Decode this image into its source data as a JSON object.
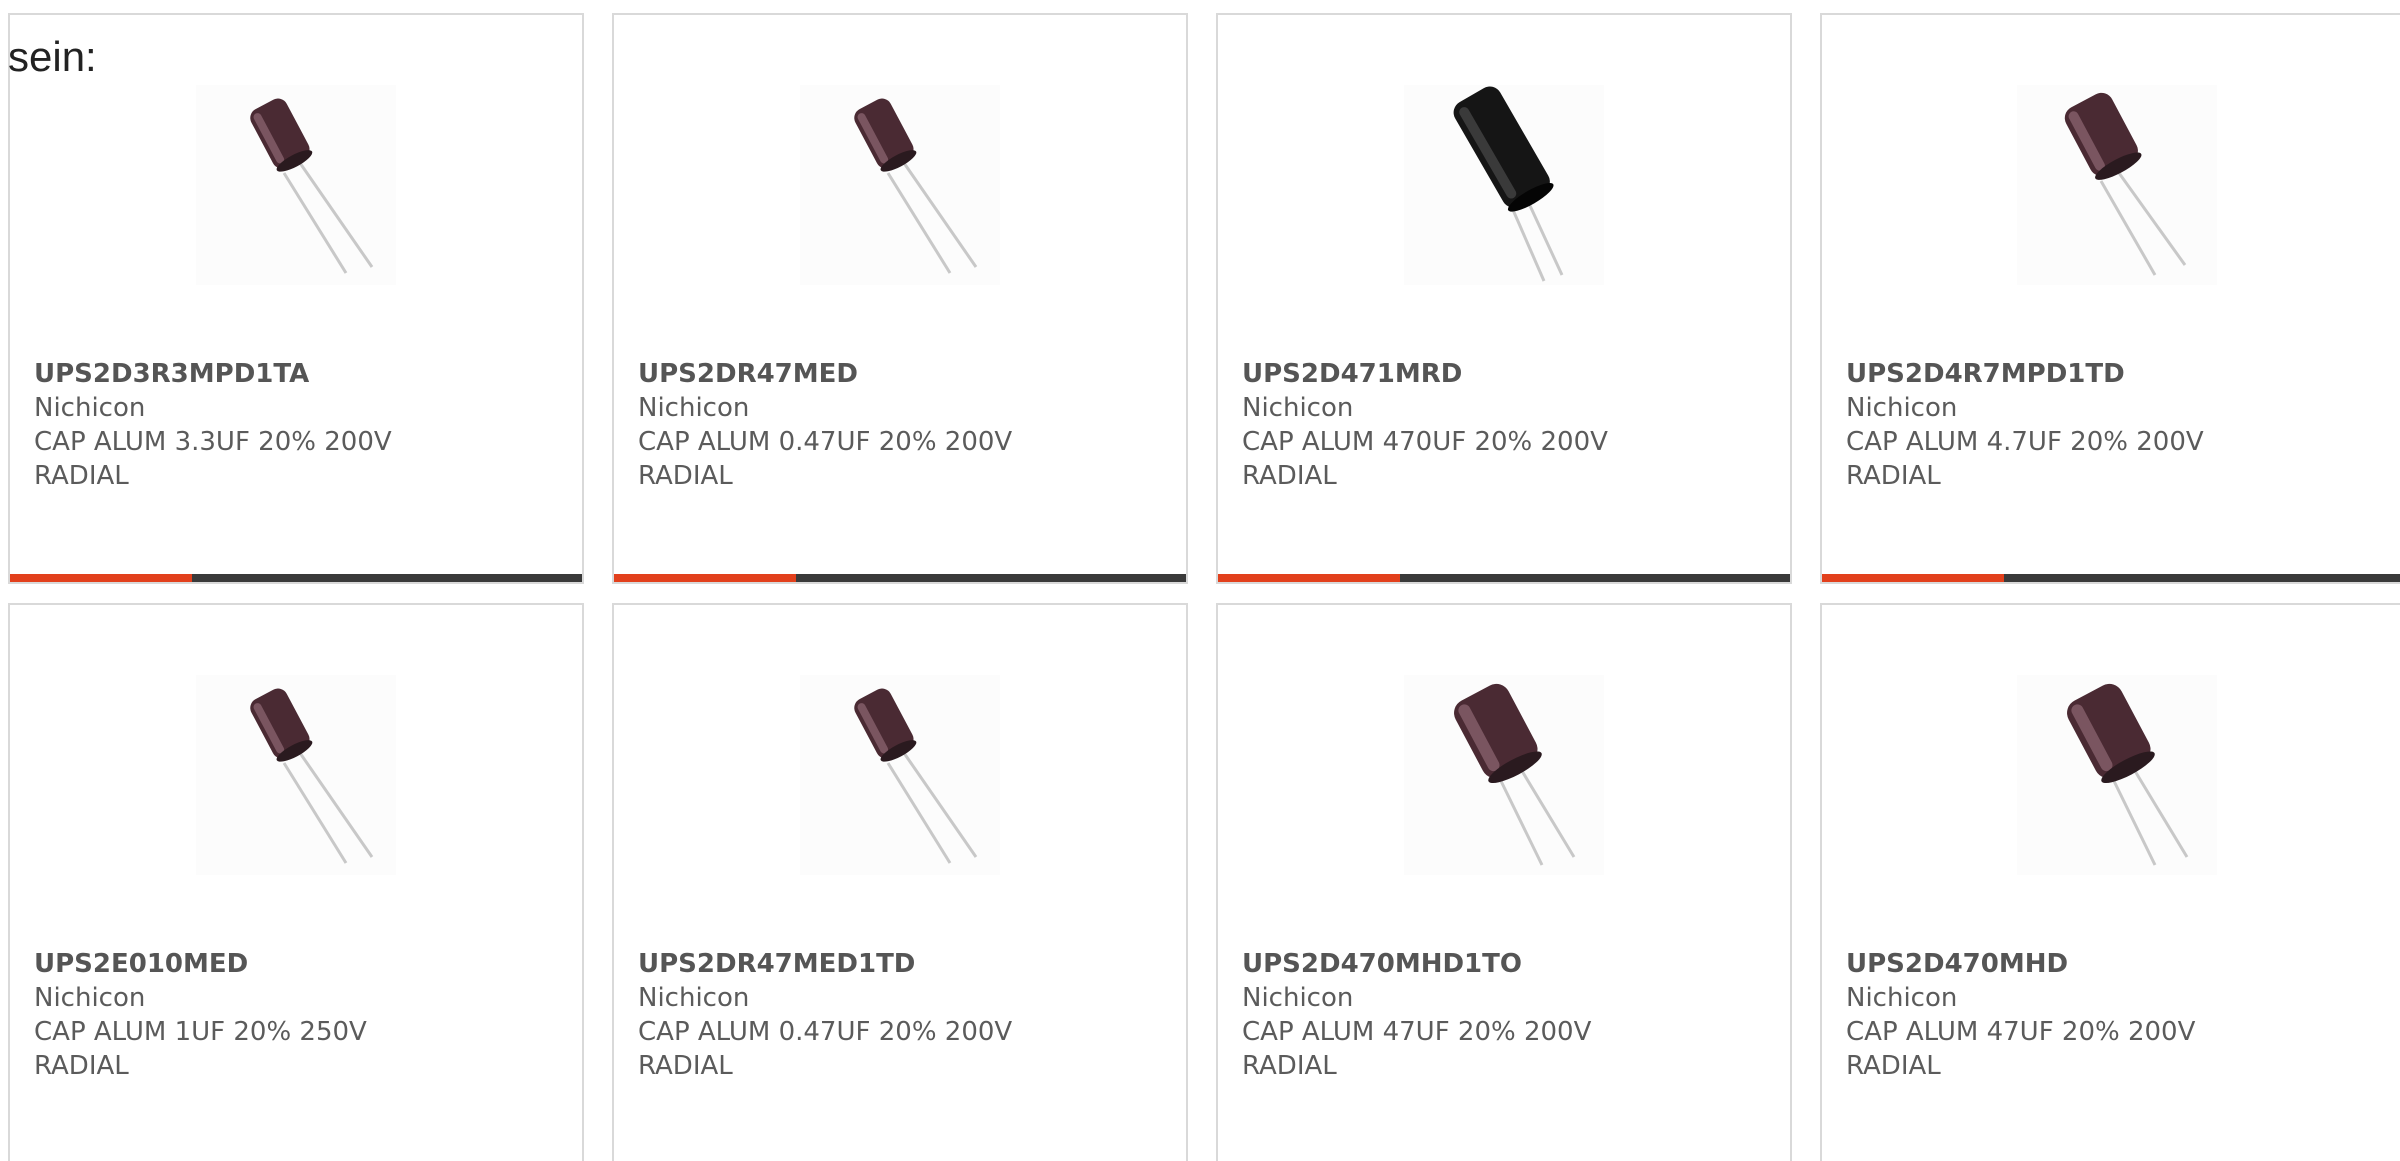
{
  "intro_text": "sein:",
  "colors": {
    "accent_bar": "#e2401c",
    "dark_bar": "#3a3a3a",
    "card_border": "#d9d9d9"
  },
  "products": [
    {
      "part": "UPS2D3R3MPD1TA",
      "manufacturer": "Nichicon",
      "desc_line1": "CAP ALUM 3.3UF 20% 200V",
      "desc_line2": "RADIAL",
      "image": "capacitor-image"
    },
    {
      "part": "UPS2DR47MED",
      "manufacturer": "Nichicon",
      "desc_line1": "CAP ALUM 0.47UF 20% 200V",
      "desc_line2": "RADIAL",
      "image": "capacitor-image"
    },
    {
      "part": "UPS2D471MRD",
      "manufacturer": "Nichicon",
      "desc_line1": "CAP ALUM 470UF 20% 200V",
      "desc_line2": "RADIAL",
      "image": "capacitor-image"
    },
    {
      "part": "UPS2D4R7MPD1TD",
      "manufacturer": "Nichicon",
      "desc_line1": "CAP ALUM 4.7UF 20% 200V",
      "desc_line2": "RADIAL",
      "image": "capacitor-image"
    },
    {
      "part": "UPS2E010MED",
      "manufacturer": "Nichicon",
      "desc_line1": "CAP ALUM 1UF 20% 250V",
      "desc_line2": "RADIAL",
      "image": "capacitor-image"
    },
    {
      "part": "UPS2DR47MED1TD",
      "manufacturer": "Nichicon",
      "desc_line1": "CAP ALUM 0.47UF 20% 200V",
      "desc_line2": "RADIAL",
      "image": "capacitor-image"
    },
    {
      "part": "UPS2D470MHD1TO",
      "manufacturer": "Nichicon",
      "desc_line1": "CAP ALUM 47UF 20% 200V",
      "desc_line2": "RADIAL",
      "image": "capacitor-image"
    },
    {
      "part": "UPS2D470MHD",
      "manufacturer": "Nichicon",
      "desc_line1": "CAP ALUM 47UF 20% 200V",
      "desc_line2": "RADIAL",
      "image": "capacitor-image"
    }
  ]
}
